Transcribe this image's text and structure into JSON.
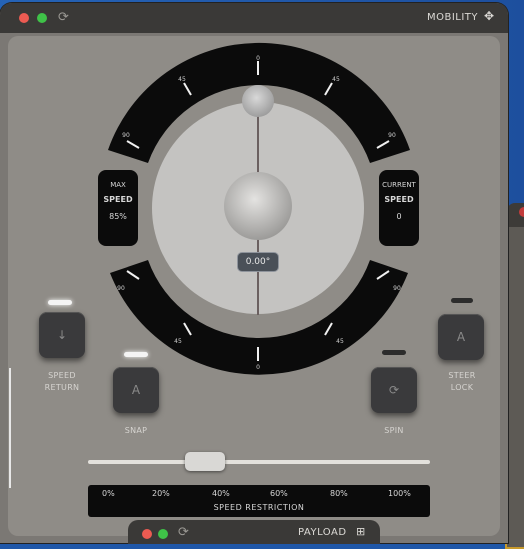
{
  "window": {
    "title": "MOBILITY",
    "move_icon": "move-icon",
    "reload_icon": "reload-icon"
  },
  "dial": {
    "top_ticks": [
      "0",
      "45",
      "45",
      "90",
      "90"
    ],
    "bottom_ticks": [
      "0",
      "45",
      "45",
      "90",
      "90"
    ],
    "readout": "0.00°",
    "left_box": {
      "line1": "MAX",
      "line2": "SPEED",
      "line3": "85%"
    },
    "right_box": {
      "line1": "CURRENT",
      "line2": "SPEED",
      "line3": "0"
    }
  },
  "buttons": {
    "speed_return": {
      "label_line1": "SPEED",
      "label_line2": "RETURN",
      "glyph": "↓",
      "led": "on"
    },
    "snap": {
      "label": "SNAP",
      "glyph": "A",
      "led": "on"
    },
    "spin": {
      "label": "SPIN",
      "glyph": "⟳",
      "led": "off"
    },
    "steer_lock": {
      "label_line1": "STEER",
      "label_line2": "LOCK",
      "glyph": "A",
      "led": "off"
    }
  },
  "speed_slider": {
    "value_fraction": 0.32,
    "ticks": [
      "0%",
      "20%",
      "40%",
      "60%",
      "80%",
      "100%"
    ],
    "title": "SPEED RESTRICTION"
  },
  "payload_tab": {
    "title": "PAYLOAD",
    "icon": "grid-icon"
  },
  "colors": {
    "accent_led": "#f4f4f4",
    "dial_face": "#c4c3c1",
    "ring": "#0b0b0b"
  }
}
